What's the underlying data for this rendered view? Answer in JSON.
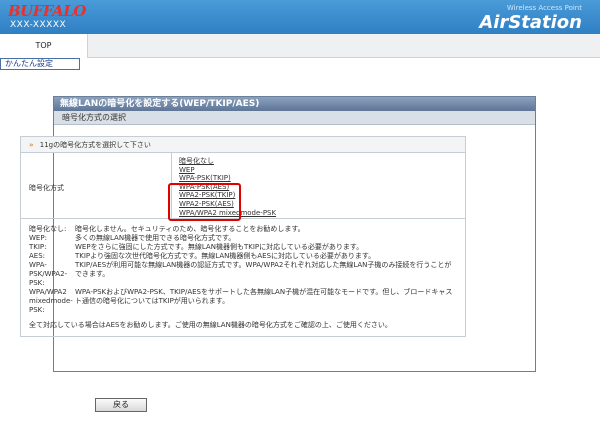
{
  "header": {
    "brand": "BUFFALO",
    "model": "XXX-XXXXX",
    "tagline": "Wireless Access Point",
    "product": "AirStation"
  },
  "nav": {
    "top_tab": "TOP",
    "sub_link": "かんたん設定"
  },
  "panel": {
    "title": "無線LANの暗号化を設定する(WEP/TKIP/AES)",
    "section": "暗号化方式の選択",
    "guide": "11gの暗号化方式を選択して下さい",
    "enc_label": "暗号化方式",
    "options": [
      "暗号化なし",
      "WEP",
      "WPA-PSK(TKIP)",
      "WPA-PSK(AES)",
      "WPA2-PSK(TKIP)",
      "WPA2-PSK(AES)",
      "WPA/WPA2 mixedmode-PSK"
    ],
    "legend": [
      {
        "key": "暗号化なし:",
        "desc": "暗号化しません。セキュリティのため、暗号化することをお勧めします。"
      },
      {
        "key": "WEP:",
        "desc": "多くの無線LAN機器で使用できる暗号化方式です。"
      },
      {
        "key": "TKIP:",
        "desc": "WEPをさらに強固にした方式です。無線LAN機器側もTKIPに対応している必要があります。"
      },
      {
        "key": "AES:",
        "desc": "TKIPより強固な次世代暗号化方式です。無線LAN機器側もAESに対応している必要があります。"
      },
      {
        "key": "WPA-PSK/WPA2-PSK:",
        "desc": "TKIP/AESが利用可能な無線LAN機器の認証方式です。WPA/WPA2それぞれ対応した無線LAN子機のみ接続を行うことができます。"
      },
      {
        "key": "WPA/WPA2 mixedmode-PSK:",
        "desc": "WPA-PSKおよびWPA2-PSK、TKIP/AESをサポートした各無線LAN子機が混在可能なモードです。但し、ブロードキャスト通信の暗号化についてはTKIPが用いられます。"
      }
    ],
    "note": "全て対応している場合はAESをお勧めします。ご使用の無線LAN機器の暗号化方式をご確認の上、ご使用ください。"
  },
  "footer": {
    "back_label": "戻る"
  },
  "colors": {
    "header_blue": "#2f7fc4",
    "brand_red": "#e8312a",
    "highlight_red": "#e00000"
  }
}
